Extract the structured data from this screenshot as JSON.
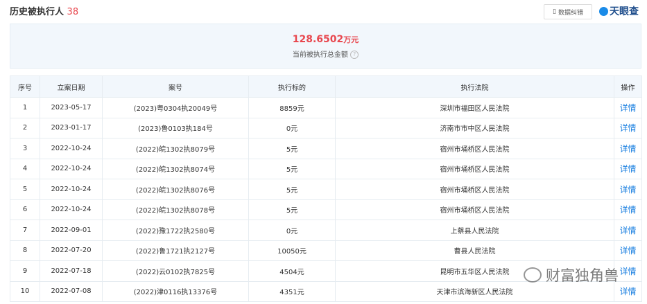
{
  "header": {
    "title": "历史被执行人",
    "count": "38",
    "fix_button": "数据纠错",
    "logo": "天眼查"
  },
  "summary": {
    "amount": "128.6502",
    "unit": "万元",
    "label": "当前被执行总金额",
    "help": "?"
  },
  "table": {
    "columns": [
      "序号",
      "立案日期",
      "案号",
      "执行标的",
      "执行法院",
      "操作"
    ],
    "rows": [
      {
        "no": "1",
        "date": "2023-05-17",
        "case": "(2023)粤0304执20049号",
        "amount": "8859元",
        "court": "深圳市福田区人民法院",
        "action": "详情"
      },
      {
        "no": "2",
        "date": "2023-01-17",
        "case": "(2023)鲁0103执184号",
        "amount": "0元",
        "court": "济南市市中区人民法院",
        "action": "详情"
      },
      {
        "no": "3",
        "date": "2022-10-24",
        "case": "(2022)皖1302执8079号",
        "amount": "5元",
        "court": "宿州市埇桥区人民法院",
        "action": "详情"
      },
      {
        "no": "4",
        "date": "2022-10-24",
        "case": "(2022)皖1302执8074号",
        "amount": "5元",
        "court": "宿州市埇桥区人民法院",
        "action": "详情"
      },
      {
        "no": "5",
        "date": "2022-10-24",
        "case": "(2022)皖1302执8076号",
        "amount": "5元",
        "court": "宿州市埇桥区人民法院",
        "action": "详情"
      },
      {
        "no": "6",
        "date": "2022-10-24",
        "case": "(2022)皖1302执8078号",
        "amount": "5元",
        "court": "宿州市埇桥区人民法院",
        "action": "详情"
      },
      {
        "no": "7",
        "date": "2022-09-01",
        "case": "(2022)豫1722执2580号",
        "amount": "0元",
        "court": "上蔡县人民法院",
        "action": "详情"
      },
      {
        "no": "8",
        "date": "2022-07-20",
        "case": "(2022)鲁1721执2127号",
        "amount": "10050元",
        "court": "曹县人民法院",
        "action": "详情"
      },
      {
        "no": "9",
        "date": "2022-07-18",
        "case": "(2022)云0102执7825号",
        "amount": "4504元",
        "court": "昆明市五华区人民法院",
        "action": "详情"
      },
      {
        "no": "10",
        "date": "2022-07-08",
        "case": "(2022)津0116执13376号",
        "amount": "4351元",
        "court": "天津市滨海新区人民法院",
        "action": "详情"
      }
    ]
  },
  "watermark": "财富独角兽"
}
